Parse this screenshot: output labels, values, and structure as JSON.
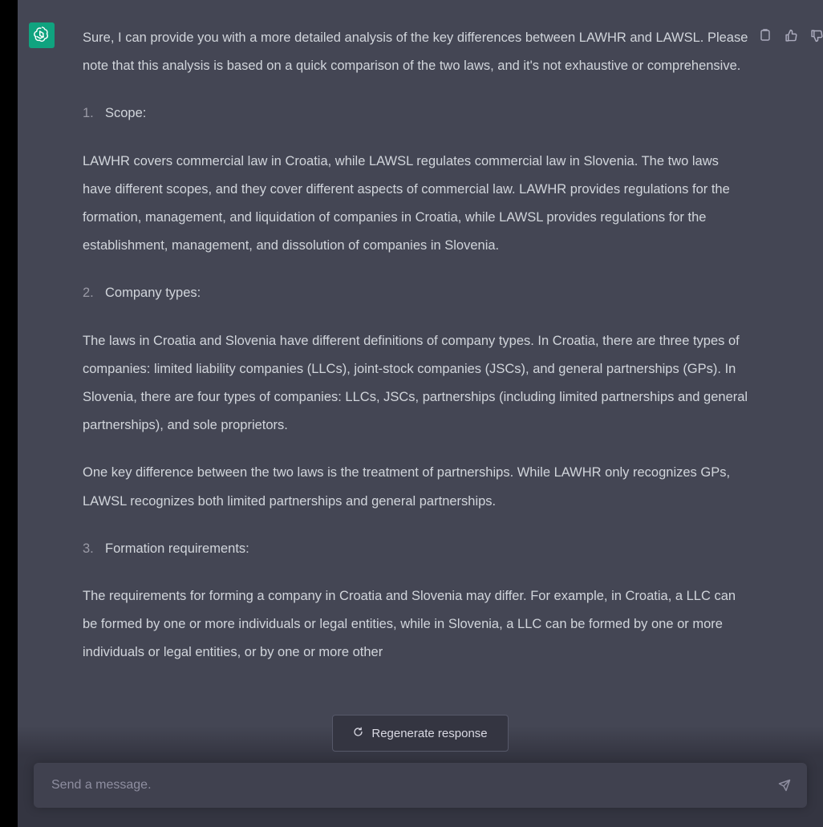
{
  "assistant": {
    "avatar_icon": "openai-logo-icon",
    "avatar_color": "#10a37f",
    "actions": [
      {
        "name": "copy-icon"
      },
      {
        "name": "thumbs-up-icon"
      },
      {
        "name": "thumbs-down-icon"
      }
    ]
  },
  "message": {
    "intro": "Sure, I can provide you with a more detailed analysis of the key differences between LAWHR and LAWSL. Please note that this analysis is based on a quick comparison of the two laws, and it's not exhaustive or comprehensive.",
    "section1_num": "1.",
    "section1_title": "Scope:",
    "section1_body": "LAWHR covers commercial law in Croatia, while LAWSL regulates commercial law in Slovenia. The two laws have different scopes, and they cover different aspects of commercial law. LAWHR provides regulations for the formation, management, and liquidation of companies in Croatia, while LAWSL provides regulations for the establishment, management, and dissolution of companies in Slovenia.",
    "section2_num": "2.",
    "section2_title": "Company types:",
    "section2_body1": "The laws in Croatia and Slovenia have different definitions of company types. In Croatia, there are three types of companies: limited liability companies (LLCs), joint-stock companies (JSCs), and general partnerships (GPs). In Slovenia, there are four types of companies: LLCs, JSCs, partnerships (including limited partnerships and general partnerships), and sole proprietors.",
    "section2_body2": "One key difference between the two laws is the treatment of partnerships. While LAWHR only recognizes GPs, LAWSL recognizes both limited partnerships and general partnerships.",
    "section3_num": "3.",
    "section3_title": "Formation requirements:",
    "section3_body": "The requirements for forming a company in Croatia and Slovenia may differ. For example, in Croatia, a LLC can be formed by one or more individuals or legal entities, while in Slovenia, a LLC can be formed by one or more individuals or legal entities, or by one or more other"
  },
  "regenerate": {
    "label": "Regenerate response",
    "icon": "refresh-icon"
  },
  "composer": {
    "placeholder": "Send a message.",
    "send_icon": "send-icon"
  }
}
